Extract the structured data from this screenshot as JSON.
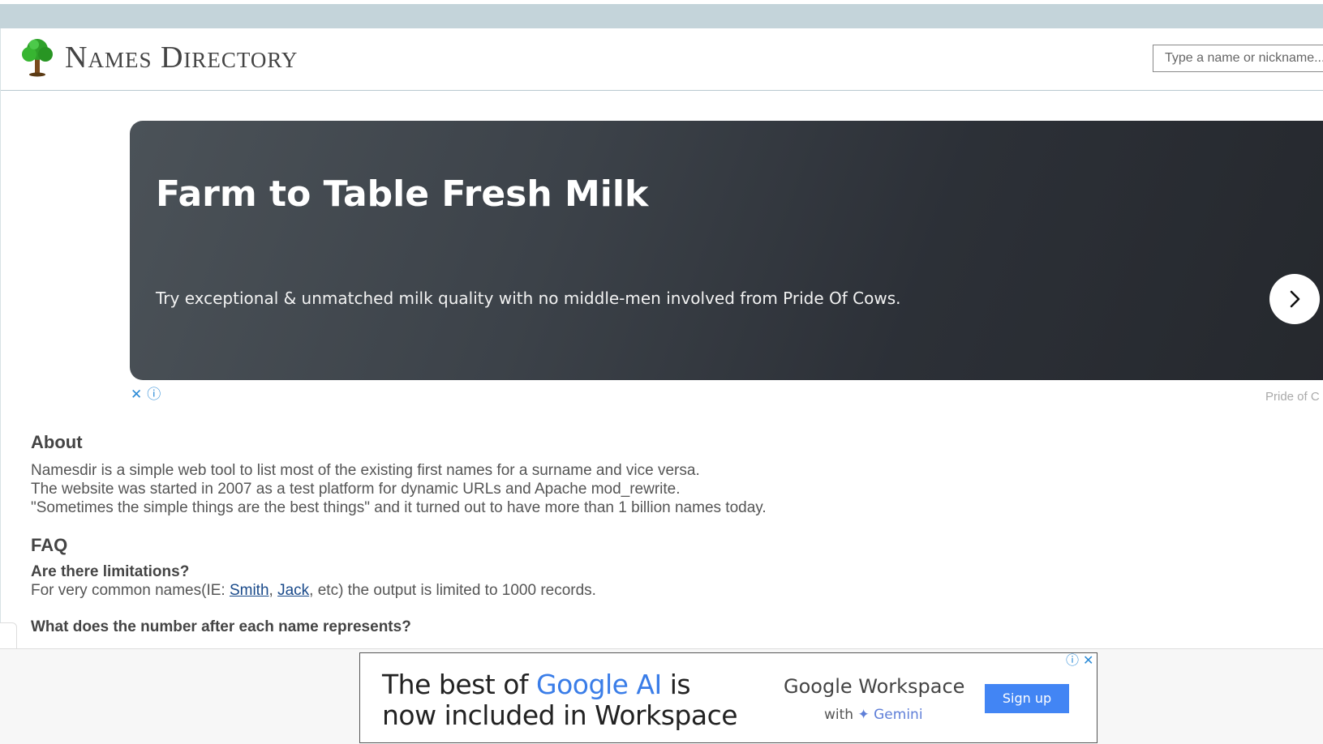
{
  "header": {
    "brand": "Names Directory",
    "search_placeholder": "Type a name or nickname..."
  },
  "ad_top": {
    "title": "Farm to Table Fresh Milk",
    "subtitle": "Try exceptional & unmatched milk quality with no middle-men involved from Pride Of Cows.",
    "close_glyph": "✕",
    "info_glyph": "ⓘ",
    "arrow_glyph": "›",
    "source": "Pride of C"
  },
  "about": {
    "heading": "About",
    "lines": [
      "Namesdir is a simple web tool to list most of the existing first names for a surname and vice versa.",
      "The website was started in 2007 as a test platform for dynamic URLs and Apache mod_rewrite.",
      "\"Sometimes the simple things are the best things\" and it turned out to have more than 1 billion names today."
    ]
  },
  "faq": {
    "heading": "FAQ",
    "q1": "Are there limitations?",
    "a1_prefix": "For very common names(IE: ",
    "a1_link1": "Smith",
    "a1_sep": ", ",
    "a1_link2": "Jack",
    "a1_suffix": ", etc) the output is limited to 1000 records.",
    "q2": "What does the number after each name represents?"
  },
  "ad_bottom": {
    "headline_prefix": "The best of ",
    "headline_blue": "Google AI",
    "headline_mid": " is",
    "headline_line2": "now included in Workspace",
    "brand": "Google Workspace",
    "with_label": "with",
    "gemini_label": "✦ Gemini",
    "button": "Sign up",
    "info_glyph": "ⓘ",
    "close_glyph": "✕"
  },
  "colors": {
    "topstrip": "#c4d4da",
    "ad_dark": "#2c3037",
    "link": "#1a4a8a",
    "cta_blue": "#4285f4"
  },
  "icons": {
    "logo": "tree-icon",
    "arrow": "chevron-right-icon"
  }
}
